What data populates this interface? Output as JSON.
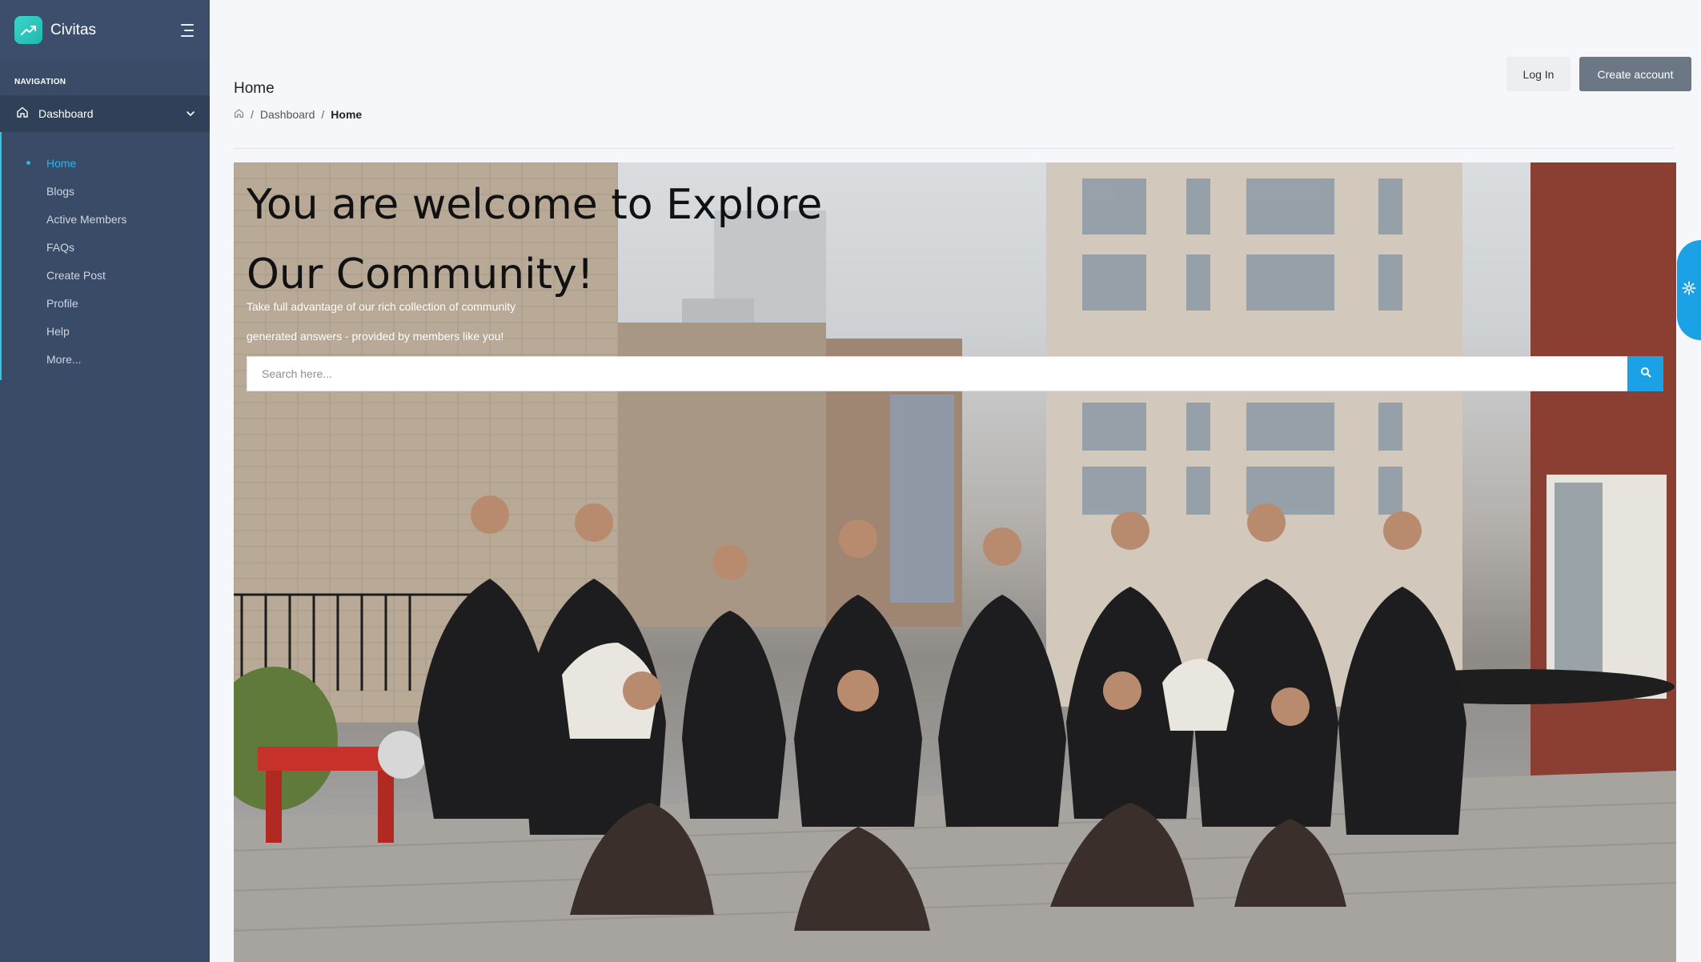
{
  "brand": {
    "name": "Civitas",
    "logo_icon": "trending-up-icon",
    "accent": "#2dc8c0"
  },
  "sidebar": {
    "caption": "NAVIGATION",
    "group": {
      "label": "Dashboard",
      "icon": "home-icon"
    },
    "items": [
      {
        "label": "Home",
        "active": true
      },
      {
        "label": "Blogs"
      },
      {
        "label": "Active Members"
      },
      {
        "label": "FAQs"
      },
      {
        "label": "Create Post"
      },
      {
        "label": "Profile"
      },
      {
        "label": "Help"
      },
      {
        "label": "More..."
      }
    ]
  },
  "header": {
    "title": "Home",
    "breadcrumb": {
      "sep": "/",
      "parent": "Dashboard",
      "current": "Home"
    },
    "login_label": "Log In",
    "create_label": "Create account"
  },
  "hero": {
    "title_line1": "You are welcome to Explore",
    "title_line2": "Our Community!",
    "subtitle_line1": "Take full advantage of our rich collection of community",
    "subtitle_line2": "generated answers - provided by members like you!",
    "search_placeholder": "Search here...",
    "search_value": ""
  },
  "colors": {
    "sidebar_bg": "#3a4b67",
    "primary": "#1aa1e6",
    "active_link": "#23b8eb"
  }
}
